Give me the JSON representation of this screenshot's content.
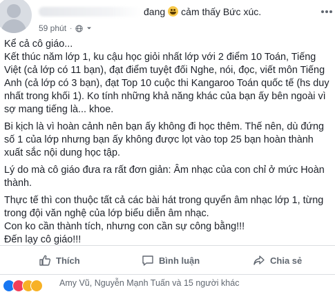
{
  "header": {
    "feeling_prefix": "đang",
    "feeling_text": "cảm thấy Bức xúc.",
    "time": "59 phút",
    "separator": "·",
    "privacy_icon": "globe-icon",
    "menu_icon": "more-icon"
  },
  "post": {
    "paragraphs": [
      "Kể cả cô giáo...",
      "Kết thúc năm lớp 1, ku cậu học giỏi nhất lớp với 2 điểm 10 Toán, Tiếng Việt (cả lớp có 11 bạn), đạt điểm tuyệt đối Nghe, nói, đọc, viết môn Tiếng Anh (cả lớp có 3 bạn), đạt Top 10 cuộc thi Kangaroo Toán quốc tế (hs duy nhất trong khối 1). Ko tính những khả năng khác của bạn ấy bên ngoài vì sợ mang tiếng là... khoe.",
      "Bi kịch là vì hoàn cảnh nên bạn ấy không đi học thêm. Thế nên, dù đứng số 1 của lớp nhưng bạn ấy không được lọt vào top 25 bạn hoàn thành xuất sắc nội dung học tập.",
      "Lý do mà cô giáo đưa ra rất đơn giản: Âm nhạc của con chỉ ở mức Hoàn thành.",
      "Thực tế thì con thuộc tất cả các bài hát trong quyển âm nhạc lớp 1, từng trong đội văn nghệ của lớp biểu diễn âm nhạc.",
      "Con ko cần thành tích, nhưng con cần sự công bằng!!!",
      "Đến lạy cô giáo!!!"
    ]
  },
  "actions": {
    "like_label": "Thích",
    "comment_label": "Bình luận",
    "share_label": "Chia sẻ"
  },
  "reactions": {
    "summary": "Amy Vũ, Nguyễn Mạnh Tuấn và 15 người khác",
    "types": [
      "like-icon",
      "love-icon",
      "haha-icon",
      "sad-icon"
    ]
  },
  "colors": {
    "text": "#1d2129",
    "muted": "#606770",
    "divider": "#dadde1",
    "like_blue": "#1877f2"
  }
}
